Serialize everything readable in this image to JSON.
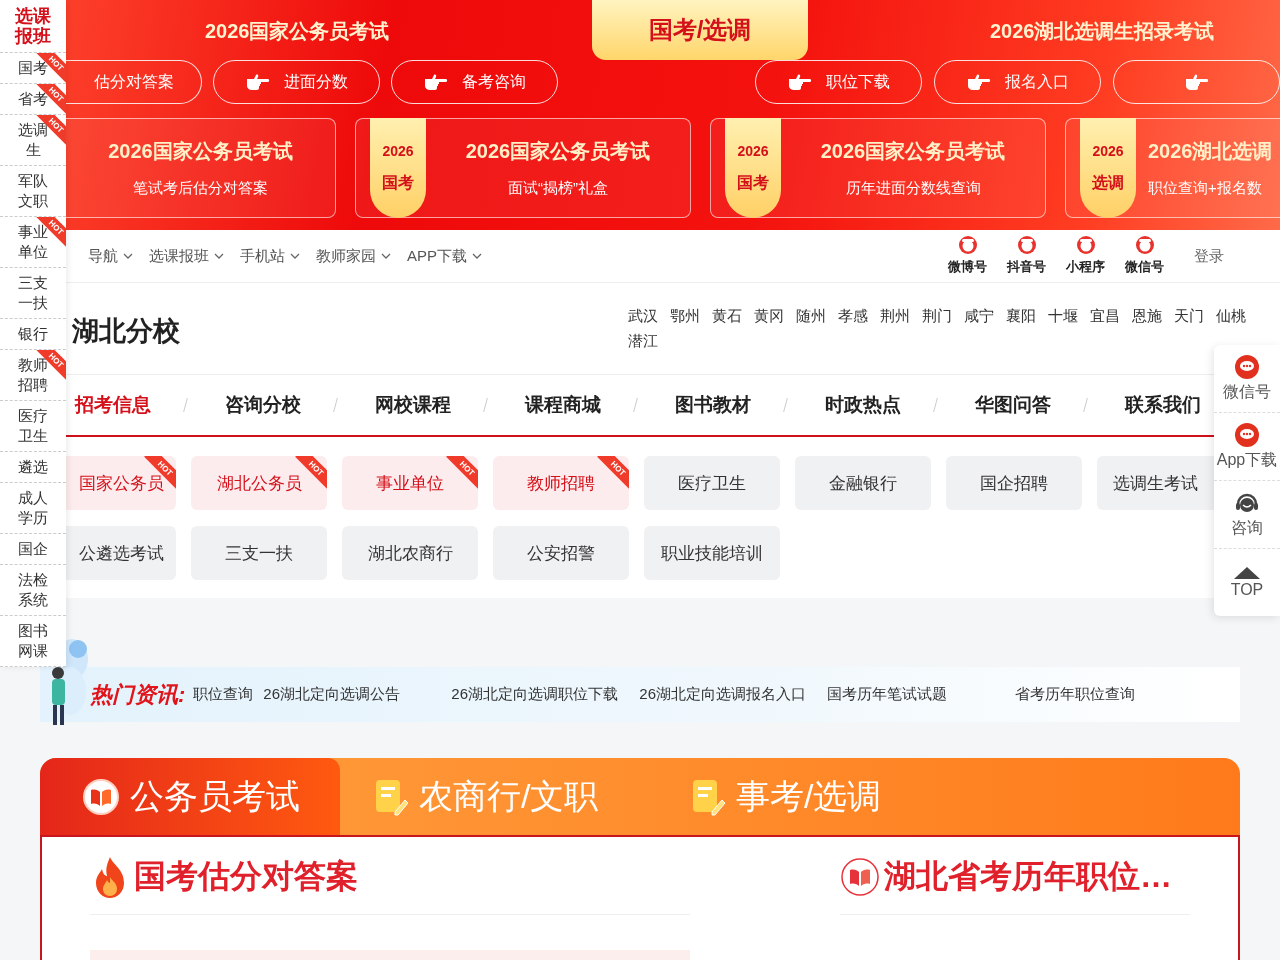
{
  "sidebar": {
    "title": "选课报班",
    "items": [
      {
        "label": "国考",
        "badge": "HOT"
      },
      {
        "label": "省考",
        "badge": "HOT"
      },
      {
        "label": "选调生",
        "badge": "HOT"
      },
      {
        "label": "军队文职"
      },
      {
        "label": "事业单位",
        "badge": "HOT"
      },
      {
        "label": "三支一扶"
      },
      {
        "label": "银行"
      },
      {
        "label": "教师招聘",
        "badge": "HOT"
      },
      {
        "label": "医疗卫生"
      },
      {
        "label": "遴选"
      },
      {
        "label": "成人学历"
      },
      {
        "label": "国企"
      },
      {
        "label": "法检系统"
      },
      {
        "label": "图书网课"
      }
    ]
  },
  "banner": {
    "tabs": [
      {
        "label": "2026国家公务员考试",
        "selected": false
      },
      {
        "label": "国考/选调",
        "selected": true
      },
      {
        "label": "2026湖北选调生招录考试",
        "selected": false
      }
    ],
    "buttons_left": [
      {
        "label": "估分对答案",
        "icon": false
      },
      {
        "label": "进面分数",
        "icon": true
      },
      {
        "label": "备考咨询",
        "icon": true
      }
    ],
    "buttons_right": [
      {
        "label": "职位下载",
        "icon": true
      },
      {
        "label": "报名入口",
        "icon": true
      },
      {
        "icon": true
      }
    ],
    "cards": [
      {
        "title": "2026国家公务员考试",
        "subtitle": "笔试考后估分对答案"
      },
      {
        "badge_year": "2026",
        "badge_label": "国考",
        "title": "2026国家公务员考试",
        "subtitle": "面试“揭榜”礼盒"
      },
      {
        "badge_year": "2026",
        "badge_label": "国考",
        "title": "2026国家公务员考试",
        "subtitle": "历年进面分数线查询"
      },
      {
        "badge_year": "2026",
        "badge_label": "选调",
        "title": "2026湖北选调",
        "subtitle": "职位查询+报名数"
      }
    ]
  },
  "topbar": {
    "nav": [
      {
        "label": "导航"
      },
      {
        "label": "选课报班"
      },
      {
        "label": "手机站"
      },
      {
        "label": "教师家园"
      },
      {
        "label": "APP下载"
      }
    ],
    "social": [
      {
        "label": "微博号"
      },
      {
        "label": "抖音号"
      },
      {
        "label": "小程序"
      },
      {
        "label": "微信号"
      }
    ],
    "login": "登录"
  },
  "header": {
    "title": "湖北分校",
    "cities": [
      "武汉",
      "鄂州",
      "黄石",
      "黄冈",
      "随州",
      "孝感",
      "荆州",
      "荆门",
      "咸宁",
      "襄阳",
      "十堰",
      "宜昌",
      "恩施",
      "天门",
      "仙桃",
      "潜江"
    ]
  },
  "main_nav": [
    {
      "label": "招考信息",
      "selected": true
    },
    {
      "label": "咨询分校",
      "selected": false
    },
    {
      "label": "网校课程",
      "selected": false
    },
    {
      "label": "课程商城",
      "selected": false
    },
    {
      "label": "图书教材",
      "selected": false
    },
    {
      "label": "时政热点",
      "selected": false
    },
    {
      "label": "华图问答",
      "selected": false
    },
    {
      "label": "联系我们",
      "selected": false
    }
  ],
  "categories": [
    {
      "label": "国家公务员",
      "hot": true,
      "badge": "HOT"
    },
    {
      "label": "湖北公务员",
      "hot": true,
      "badge": "HOT"
    },
    {
      "label": "事业单位",
      "hot": true,
      "badge": "HOT"
    },
    {
      "label": "教师招聘",
      "hot": true,
      "badge": "HOT"
    },
    {
      "label": "医疗卫生",
      "hot": false
    },
    {
      "label": "金融银行",
      "hot": false
    },
    {
      "label": "国企招聘",
      "hot": false
    },
    {
      "label": "选调生考试",
      "hot": false
    },
    {
      "label": "公遴选考试",
      "hot": false
    },
    {
      "label": "三支一扶",
      "hot": false
    },
    {
      "label": "湖北农商行",
      "hot": false
    },
    {
      "label": "公安招警",
      "hot": false
    },
    {
      "label": "职业技能培训",
      "hot": false
    }
  ],
  "hot_news": {
    "title": "热门资讯:",
    "links": [
      "职位查询",
      "26湖北定向选调公告",
      "26湖北定向选调职位下载",
      "26湖北定向选调报名入口",
      "国考历年笔试试题",
      "省考历年职位查询"
    ]
  },
  "exam_tabs": [
    {
      "label": "公务员考试",
      "selected": true
    },
    {
      "label": "农商行/文职",
      "selected": false
    },
    {
      "label": "事考/选调",
      "selected": false
    }
  ],
  "sections": [
    {
      "title": "国考估分对答案",
      "kind": "flame"
    },
    {
      "title": "湖北省考历年职位…",
      "kind": "book"
    }
  ],
  "float_panel": [
    {
      "label": "微信号",
      "kind": "chat"
    },
    {
      "label": "App下载",
      "kind": "chat"
    },
    {
      "label": "咨询",
      "kind": "headset"
    },
    {
      "label": "TOP",
      "kind": "top"
    }
  ]
}
